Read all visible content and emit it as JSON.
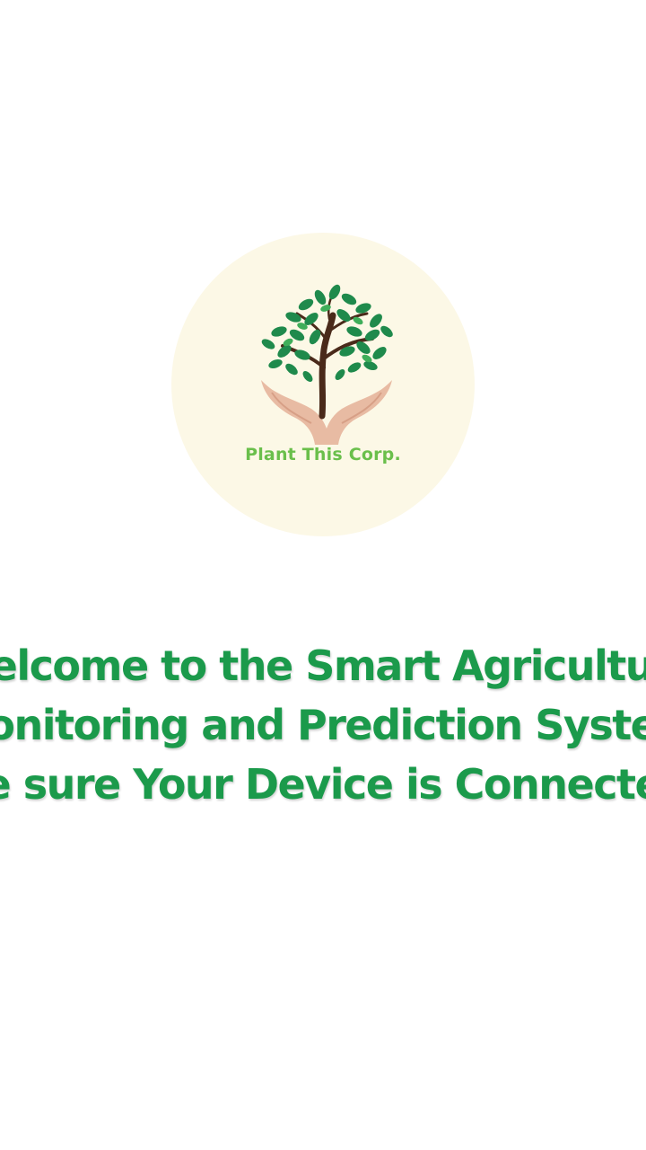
{
  "logo": {
    "company_name": "Plant This Corp.",
    "circle_color": "#fcf8e6",
    "leaf_color": "#1f8a4c",
    "trunk_color": "#4a2a1a",
    "hand_color": "#e8bba3",
    "text_color": "#6abf4b"
  },
  "welcome": {
    "line1": "Welcome to the Smart Agriculture",
    "line2": "Monitoring and Prediction System",
    "line3": "Please Make sure Your Device is Connected",
    "text_color": "#1b9a4b"
  }
}
